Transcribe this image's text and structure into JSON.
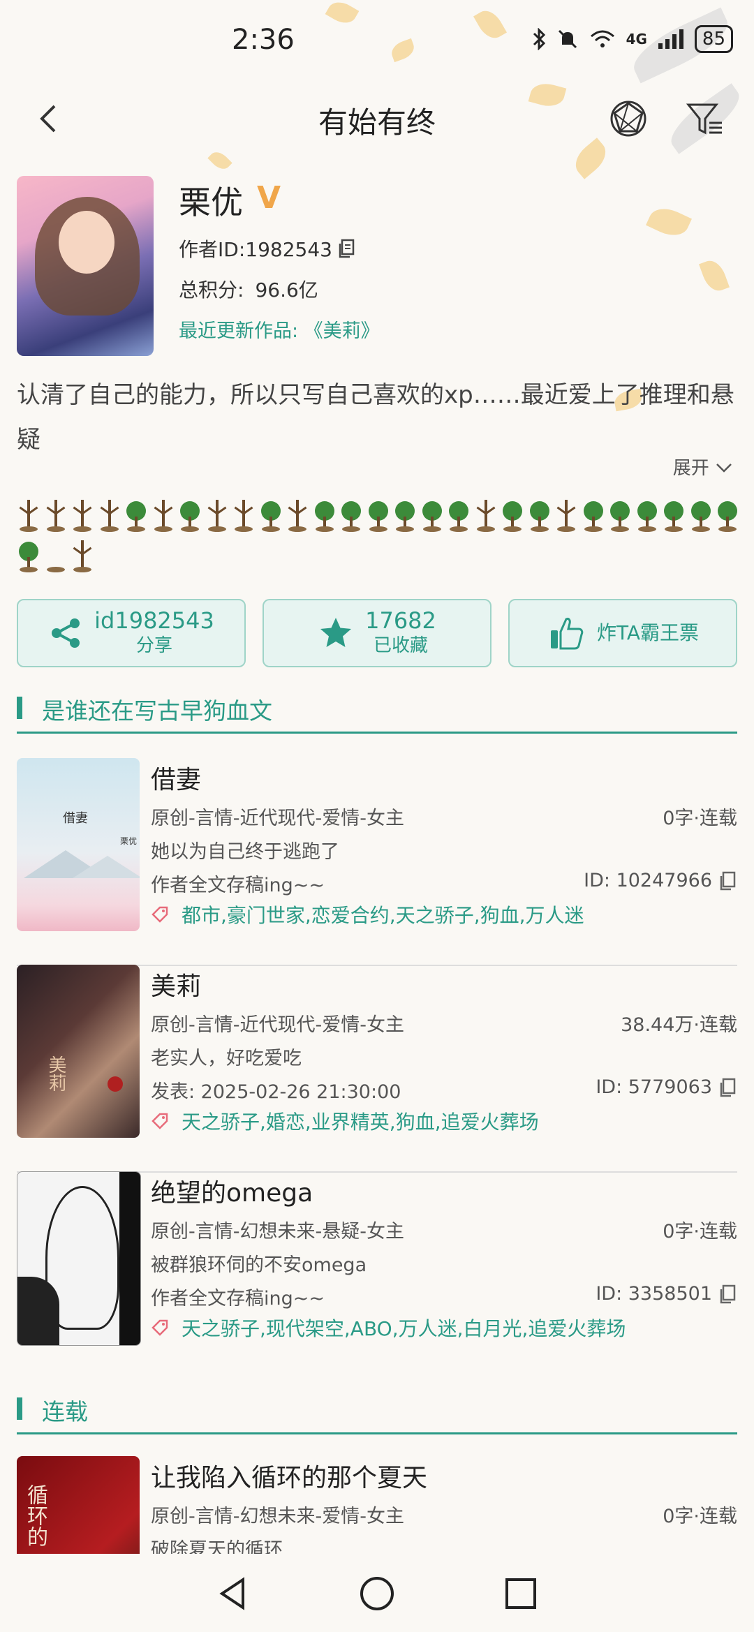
{
  "status_bar": {
    "time": "2:36",
    "signal_label": "4G",
    "battery": "85"
  },
  "nav": {
    "title": "有始有终"
  },
  "author": {
    "name": "栗优",
    "vip_badge": "V",
    "id_text": "作者ID:1982543",
    "score_label": "总积分:",
    "score_value": "96.6亿",
    "latest_text": "最近更新作品: 《美莉》",
    "bio": "认清了自己的能力，所以只写自己喜欢的xp……最近爱上了推理和悬疑",
    "expand_label": "展开"
  },
  "trees": [
    "bare",
    "bare",
    "bare",
    "bare",
    "green",
    "bare",
    "green",
    "bare",
    "bare",
    "green",
    "bare",
    "green",
    "green",
    "green",
    "green",
    "green",
    "green",
    "bare",
    "green",
    "green",
    "bare",
    "green",
    "green",
    "green",
    "green",
    "green",
    "green",
    "green",
    "stump",
    "bare"
  ],
  "actions": [
    {
      "big": "id1982543",
      "small": "分享",
      "icon": "share-icon"
    },
    {
      "big": "17682",
      "small": "已收藏",
      "icon": "star-icon"
    },
    {
      "big": "炸TA霸王票",
      "small": "",
      "icon": "thumbs-up-icon"
    }
  ],
  "sections": [
    {
      "label": "是谁还在写古早狗血文"
    },
    {
      "label": "连载"
    }
  ],
  "books": [
    {
      "title": "借妻",
      "category": "原创-言情-近代现代-爱情-女主",
      "status": "0字·连载",
      "summary": "她以为自己终于逃跑了",
      "update": "作者全文存稿ing~~",
      "id": "ID: 10247966",
      "tags": "都市,豪门世家,恋爱合约,天之骄子,狗血,万人迷",
      "cover_text": "借妻",
      "cover_author": "栗优"
    },
    {
      "title": "美莉",
      "category": "原创-言情-近代现代-爱情-女主",
      "status": "38.44万·连载",
      "summary": "老实人，好吃爱吃",
      "update": "发表: 2025-02-26 21:30:00",
      "id": "ID: 5779063",
      "tags": "天之骄子,婚恋,业界精英,狗血,追爱火葬场",
      "cover_text": "美莉"
    },
    {
      "title": "绝望的omega",
      "category": "原创-言情-幻想未来-悬疑-女主",
      "status": "0字·连载",
      "summary": "被群狼环伺的不安omega",
      "update": "作者全文存稿ing~~",
      "id": "ID: 3358501",
      "tags": "天之骄子,现代架空,ABO,万人迷,白月光,追爱火葬场"
    },
    {
      "title": "让我陷入循环的那个夏天",
      "category": "原创-言情-幻想未来-爱情-女主",
      "status": "0字·连载",
      "summary": "破除夏天的循环",
      "cover_text": "循环的"
    }
  ]
}
